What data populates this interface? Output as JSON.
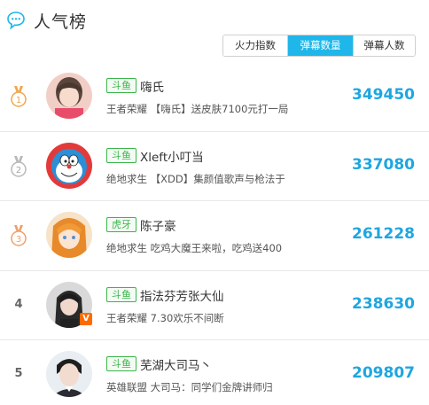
{
  "header": {
    "title": "人气榜",
    "icon": "speech-bubble-icon"
  },
  "tabs": [
    {
      "label": "火力指数",
      "active": false
    },
    {
      "label": "弹幕数量",
      "active": true
    },
    {
      "label": "弹幕人数",
      "active": false
    }
  ],
  "colors": {
    "accent": "#1fb6ea",
    "count": "#1fa6e0",
    "platform_tag": "#3ab54a",
    "medal": "#f0a64a"
  },
  "rows": [
    {
      "rank": "1",
      "rank_icon": "medal-1-icon",
      "platform": "斗鱼",
      "name": "嗨氏",
      "desc": "王者荣耀 【嗨氏】送皮肤7100元打一局",
      "count": "349450",
      "verified": false
    },
    {
      "rank": "2",
      "rank_icon": "medal-2-icon",
      "platform": "斗鱼",
      "name": "Xleft小叮当",
      "desc": "绝地求生 【XDD】集颜值歌声与枪法于",
      "count": "337080",
      "verified": false
    },
    {
      "rank": "3",
      "rank_icon": "medal-3-icon",
      "platform": "虎牙",
      "name": "陈子豪",
      "desc": "绝地求生 吃鸡大魔王来啦，吃鸡送400",
      "count": "261228",
      "verified": false
    },
    {
      "rank": "4",
      "rank_icon": "",
      "platform": "斗鱼",
      "name": "指法芬芳张大仙",
      "desc": "王者荣耀 7.30欢乐不间断",
      "count": "238630",
      "verified": true,
      "verified_label": "V"
    },
    {
      "rank": "5",
      "rank_icon": "",
      "platform": "斗鱼",
      "name": "芜湖大司马丶",
      "desc": "英雄联盟 大司马：同学们金牌讲师归",
      "count": "209807",
      "verified": false
    }
  ]
}
